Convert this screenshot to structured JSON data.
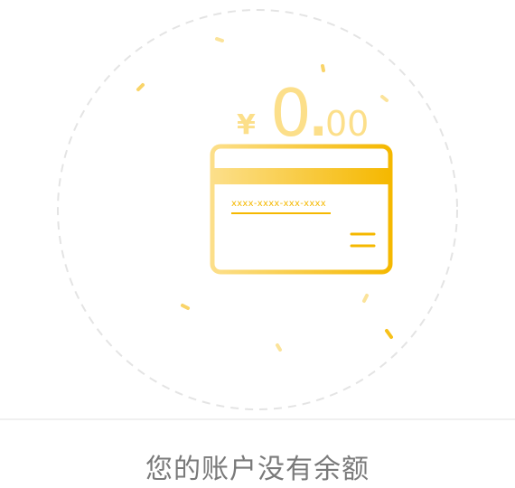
{
  "balance": {
    "currency_symbol": "¥",
    "integer": "0",
    "decimal_point": ".",
    "fraction": "00"
  },
  "card": {
    "number_mask": "xxxx-xxxx-xxx-xxxx"
  },
  "empty_state": {
    "message": "您的账户没有余额"
  },
  "colors": {
    "accent_light": "#fcdf8a",
    "accent_dark": "#f5b800",
    "circle": "#e4e4e4",
    "text": "#7a7a7a"
  }
}
